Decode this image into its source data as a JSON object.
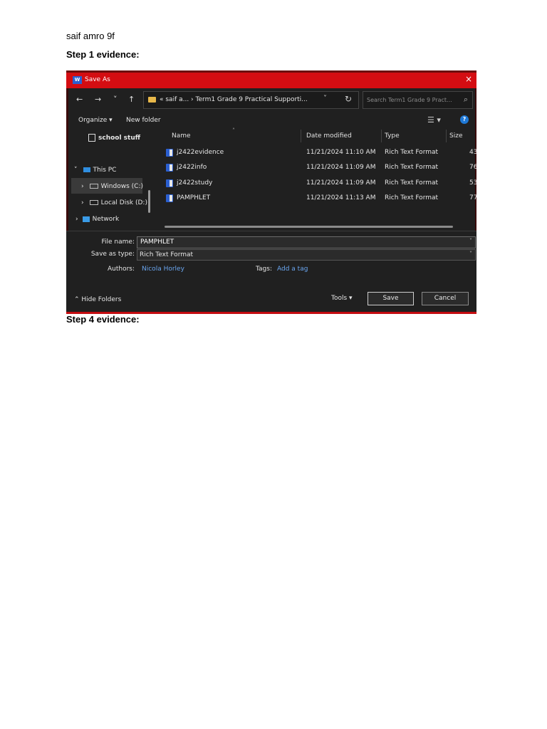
{
  "doc": {
    "author_line": "saif amro 9f",
    "step1": "Step 1 evidence:",
    "step4": "Step 4 evidence:"
  },
  "dialog": {
    "word_icon": "W",
    "title": "Save As",
    "close": "×",
    "nav": {
      "back": "←",
      "forward": "→",
      "recent": "˅",
      "up": "↑"
    },
    "address": "« saif a...  ›  Term1 Grade 9 Practical Supporti...",
    "address_chevron": "˅",
    "refresh": "↻",
    "search_placeholder": "Search Term1 Grade 9 Pract...",
    "search_icon": "⌕",
    "toolbar": {
      "organize": "Organize ▾",
      "new_folder": "New folder",
      "view": "☰ ▾",
      "help": "?"
    },
    "sidebar": {
      "school_stuff": "school stuff",
      "this_pc": "This PC",
      "windows_c": "Windows (C:)",
      "local_disk": "Local Disk (D:)",
      "network": "Network"
    },
    "columns": {
      "name": "Name",
      "date": "Date modified",
      "type": "Type",
      "size": "Size"
    },
    "files": [
      {
        "name": "j2422evidence",
        "date": "11/21/2024 11:10 AM",
        "type": "Rich Text Format",
        "size": "43"
      },
      {
        "name": "j2422info",
        "date": "11/21/2024 11:09 AM",
        "type": "Rich Text Format",
        "size": "76"
      },
      {
        "name": "j2422study",
        "date": "11/21/2024 11:09 AM",
        "type": "Rich Text Format",
        "size": "53"
      },
      {
        "name": "PAMPHLET",
        "date": "11/21/2024 11:13 AM",
        "type": "Rich Text Format",
        "size": "77"
      }
    ],
    "form": {
      "file_name_label": "File name:",
      "file_name_value": "PAMPHLET",
      "save_type_label": "Save as type:",
      "save_type_value": "Rich Text Format",
      "authors_label": "Authors:",
      "authors_value": "Nicola Horley",
      "tags_label": "Tags:",
      "tags_value": "Add a tag"
    },
    "footer": {
      "hide_folders": "⌃  Hide Folders",
      "tools": "Tools  ▾",
      "save": "Save",
      "cancel": "Cancel"
    }
  }
}
